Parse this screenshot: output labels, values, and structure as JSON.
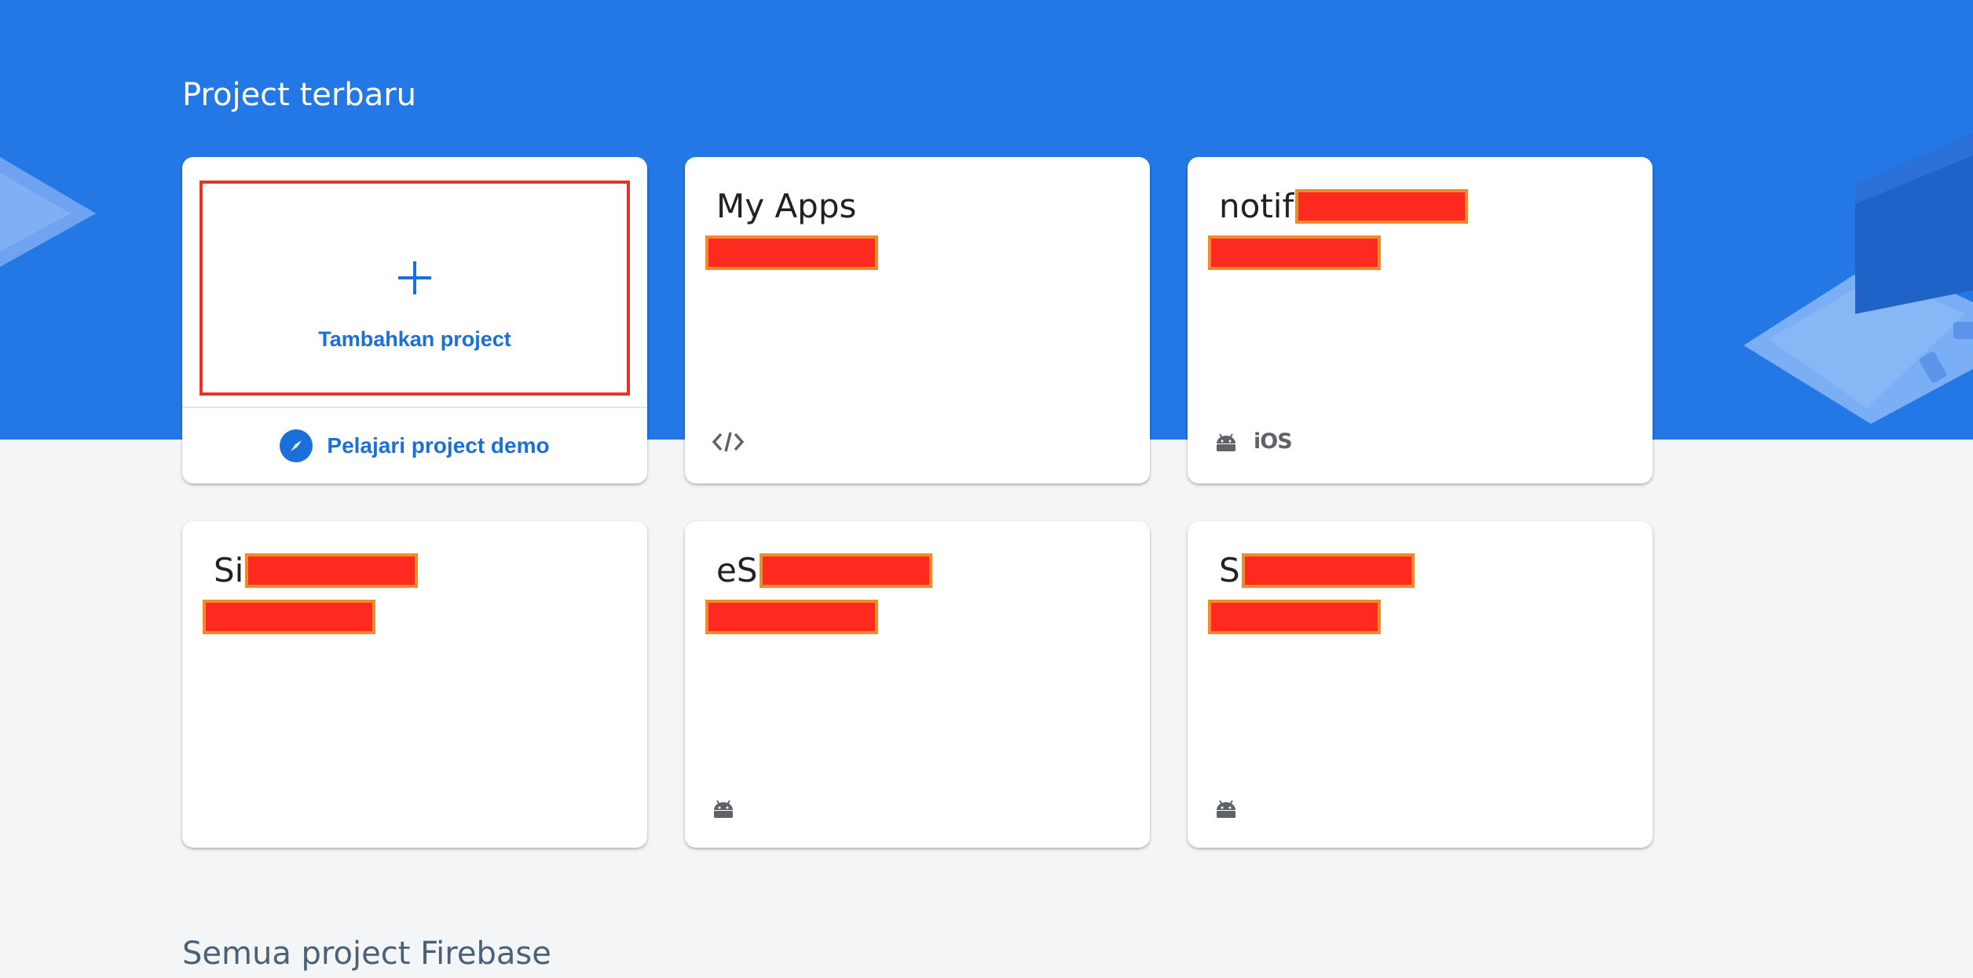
{
  "recent_section": {
    "title": "Project terbaru"
  },
  "all_section": {
    "title": "Semua project Firebase"
  },
  "add_card": {
    "label": "Tambahkan project",
    "demo_label": "Pelajari project demo"
  },
  "projects": [
    {
      "name": "My Apps",
      "name_prefix": "My Apps",
      "name_redacted": false,
      "platforms": [
        "code-icon"
      ]
    },
    {
      "name_prefix": "notif",
      "name_redacted": true,
      "platforms": [
        "android-icon",
        "ios-label"
      ],
      "ios_text": "iOS"
    },
    {
      "name_prefix": "Si",
      "name_redacted": true,
      "platforms": []
    },
    {
      "name_prefix": "eS",
      "name_redacted": true,
      "platforms": [
        "android-icon"
      ]
    },
    {
      "name_prefix": "S",
      "name_redacted": true,
      "platforms": [
        "android-icon"
      ]
    }
  ],
  "colors": {
    "hero_blue": "#2478e6",
    "link_blue": "#1a6fd9",
    "redaction_fill": "#ff2a1f",
    "redaction_border": "#f08a2a",
    "highlight_border": "#e5332a",
    "page_bg": "#f4f5f7"
  }
}
